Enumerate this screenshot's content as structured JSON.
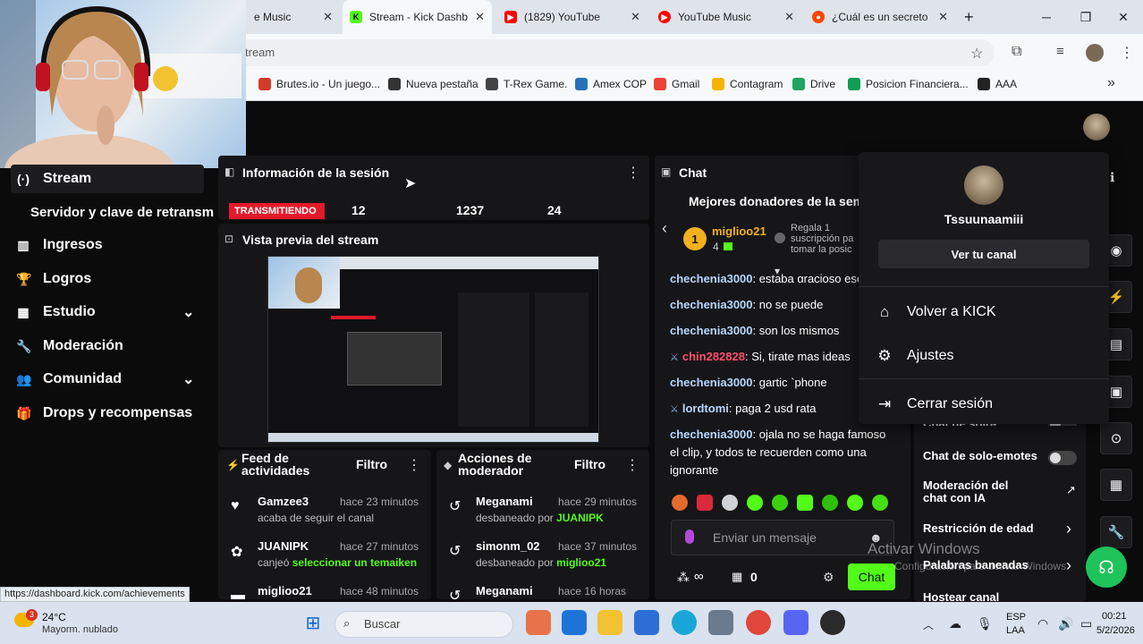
{
  "browser": {
    "tabs": [
      {
        "title": "YouTube Music",
        "visible_title": "e Music",
        "fav": "youtube-music-icon",
        "color": "#ff0000"
      },
      {
        "title": "Stream - Kick Dashboard",
        "visible_title": "Stream - Kick Dashbo",
        "fav": "kick-icon",
        "color": "#53fc18",
        "active": true
      },
      {
        "title": "(1829) YouTube",
        "visible_title": "(1829) YouTube",
        "fav": "youtube-icon",
        "color": "#ff0000"
      },
      {
        "title": "YouTube Music",
        "visible_title": "YouTube Music",
        "fav": "youtube-music-icon",
        "color": "#ff0000"
      },
      {
        "title": "¿Cuál es un secreto",
        "visible_title": "¿Cuál es un secreto c",
        "fav": "reddit-icon",
        "color": "#ff4500"
      }
    ],
    "new_tab": "+",
    "url": "tream",
    "bookmarks": [
      {
        "label": "Brutes.io - Un juego...",
        "color": "#d23b2a"
      },
      {
        "label": "Nueva pestaña",
        "color": "#333333"
      },
      {
        "label": "T-Rex Game.",
        "color": "#444444"
      },
      {
        "label": "Amex COP",
        "color": "#2671b9"
      },
      {
        "label": "Gmail",
        "color": "#ea4335"
      },
      {
        "label": "Contagram",
        "color": "#f5b400"
      },
      {
        "label": "Drive",
        "color": "#1fa463"
      },
      {
        "label": "Posicion Financiera...",
        "color": "#0f9d58"
      },
      {
        "label": "AAA",
        "color": "#222222"
      }
    ]
  },
  "sidebar": {
    "items": [
      {
        "label": "Stream",
        "icon": "broadcast-icon",
        "glyph": "(·)",
        "active": true
      },
      {
        "label": "Servidor y clave de retransm",
        "icon": "",
        "glyph": ""
      },
      {
        "label": "Ingresos",
        "icon": "bar-chart-icon",
        "glyph": "▥"
      },
      {
        "label": "Logros",
        "icon": "trophy-icon",
        "glyph": "🏆"
      },
      {
        "label": "Estudio",
        "icon": "studio-icon",
        "glyph": "▦",
        "chevron": "⌄"
      },
      {
        "label": "Moderación",
        "icon": "wrench-icon",
        "glyph": "🔧"
      },
      {
        "label": "Comunidad",
        "icon": "users-icon",
        "glyph": "👥",
        "chevron": "⌄"
      },
      {
        "label": "Drops y recompensas",
        "icon": "gift-icon",
        "glyph": "🎁"
      }
    ]
  },
  "session": {
    "title": "Información de la sesión",
    "badge": "TRANSMITIENDO",
    "badge_color": "#e4192a",
    "stats": [
      "12",
      "1237",
      "24"
    ]
  },
  "preview": {
    "title": "Vista previa del stream"
  },
  "activity": {
    "title": "Feed de actividades",
    "filter": "Filtro",
    "items": [
      {
        "name": "Gamzee3",
        "time": "hace 23 minutos",
        "text": "acaba de seguir el canal",
        "highlight": "",
        "icon": "heart-icon",
        "glyph": "♥"
      },
      {
        "name": "JUANIPK",
        "time": "hace 27 minutos",
        "text": "canjeó",
        "highlight": "seleccionar un temaiken",
        "icon": "gift-icon",
        "glyph": "✿"
      },
      {
        "name": "miglioo21",
        "time": "hace 48 minutos",
        "text": "",
        "highlight": "",
        "icon": "money-icon",
        "glyph": "▬"
      }
    ]
  },
  "modactions": {
    "title": "Acciones de moderador",
    "filter": "Filtro",
    "items": [
      {
        "name": "Meganami",
        "time": "hace 29 minutos",
        "text": "desbaneado por",
        "highlight": "JUANIPK"
      },
      {
        "name": "simonm_02",
        "time": "hace 37 minutos",
        "text": "desbaneado por",
        "highlight": "miglioo21"
      },
      {
        "name": "Meganami",
        "time": "hace 16 horas",
        "text": "",
        "highlight": ""
      }
    ]
  },
  "chat": {
    "title": "Chat",
    "donors_title": "Mejores donadores de la sema",
    "donor": {
      "name": "miglioo21",
      "rank": "1",
      "count": "4"
    },
    "donor_note": "Regala 1 suscripción pa tomar la posic",
    "messages": [
      {
        "user": "chechenia3000",
        "text": ": estaba gracioso ese",
        "mod": false,
        "red": false
      },
      {
        "user": "chechenia3000",
        "text": ": no se puede",
        "mod": false,
        "red": false
      },
      {
        "user": "chechenia3000",
        "text": ": son los mismos",
        "mod": false,
        "red": false
      },
      {
        "user": "chin282828",
        "text": ": Si, tirate mas ideas",
        "mod": true,
        "red": true
      },
      {
        "user": "chechenia3000",
        "text": ": gartic `phone",
        "mod": false,
        "red": false
      },
      {
        "user": "lordtomi",
        "text": ": paga 2 usd rata",
        "mod": true,
        "red": false
      },
      {
        "user": "chechenia3000",
        "text": ": ojala no se haga famoso el clip, y todos te recuerden como una ignorante",
        "mod": false,
        "red": false
      }
    ],
    "input_placeholder": "Enviar un mensaje",
    "viewers": "∞",
    "points": "0",
    "send_label": "Chat",
    "accent": "#53fc18"
  },
  "chat_settings": [
    {
      "label": "Chat de solo-...",
      "type": "toggle"
    },
    {
      "label": "Chat de solo-emotes",
      "type": "toggle"
    },
    {
      "label": "Moderación del chat con IA",
      "type": "link"
    },
    {
      "label": "Restricción de edad",
      "type": "arrow"
    },
    {
      "label": "Palabras baneadas",
      "type": "arrow"
    },
    {
      "label": "Hostear canal",
      "type": "none"
    }
  ],
  "user_menu": {
    "username": "Tssuunaamiii",
    "view_channel": "Ver tu canal",
    "items": [
      {
        "label": "Volver a KICK",
        "icon": "home-icon",
        "glyph": "⌂"
      },
      {
        "label": "Ajustes",
        "icon": "gear-icon",
        "glyph": "⚙"
      },
      {
        "label": "Cerrar sesión",
        "icon": "logout-icon",
        "glyph": "⇥"
      }
    ]
  },
  "watermark": {
    "line1": "Activar Windows",
    "line2": "Configuración para activar Windows"
  },
  "status_url": "https://dashboard.kick.com/achievements",
  "taskbar": {
    "weather_temp": "24°C",
    "weather_desc": "Mayorm. nublado",
    "weather_badge": "3",
    "search": "Buscar",
    "lang": "ESP",
    "lang2": "LAA",
    "time": "00:21",
    "date": "5/2/2026"
  }
}
